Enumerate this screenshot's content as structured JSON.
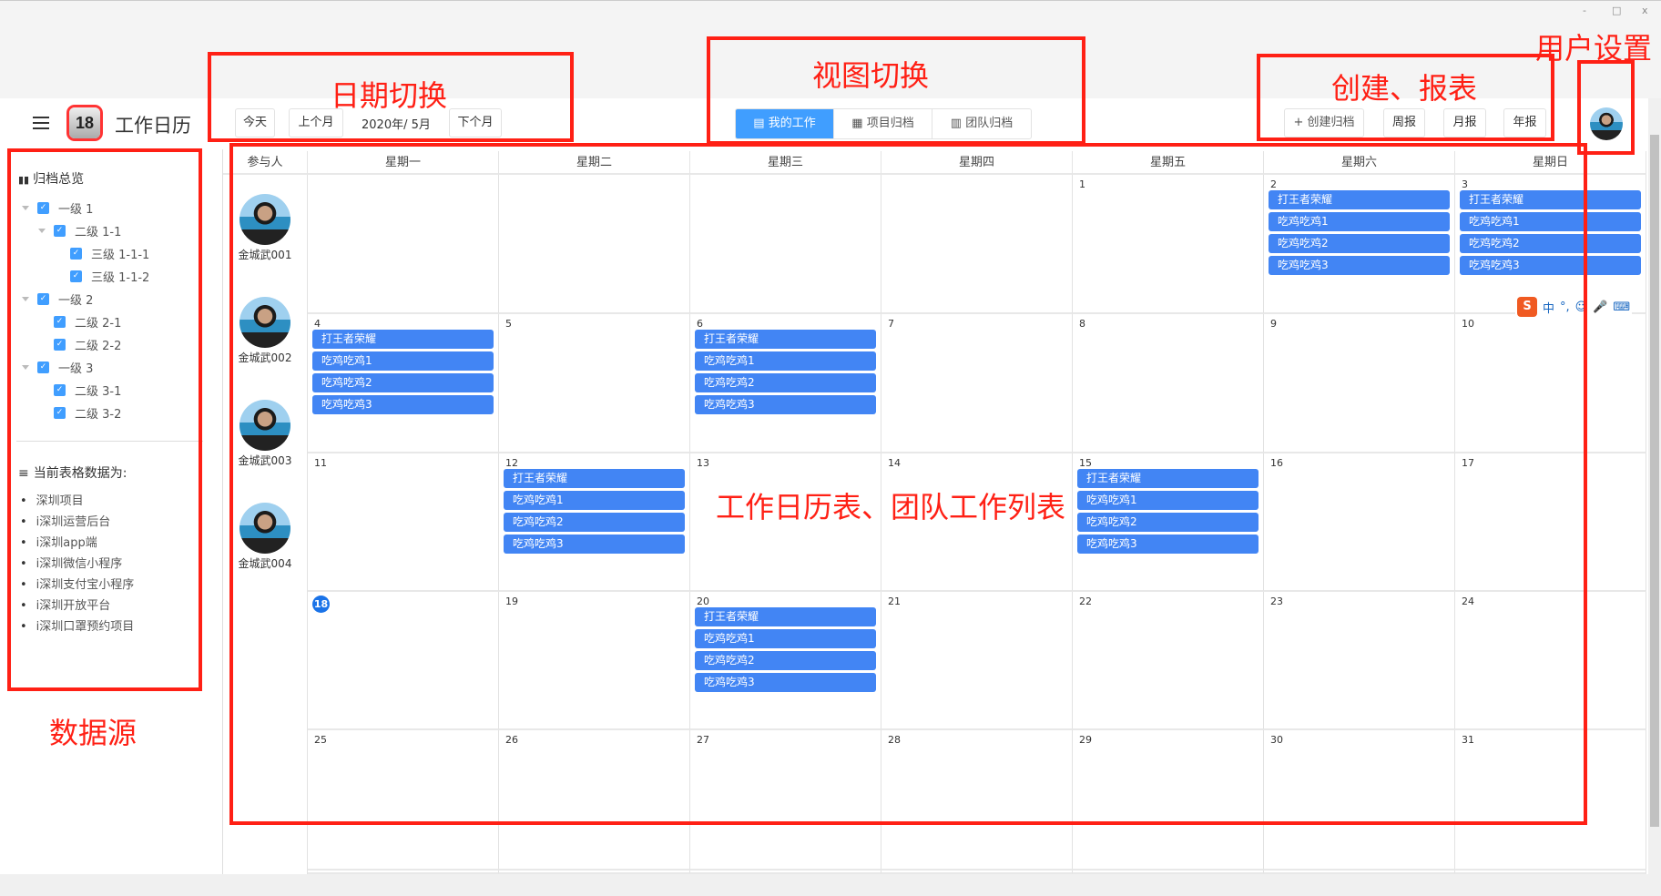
{
  "window": {
    "minimize": "-",
    "maximize": "□",
    "close": "x"
  },
  "header": {
    "title": "工作日历",
    "logo_day": "18",
    "today": "今天",
    "prev": "上个月",
    "month": "2020年/ 5月",
    "next": "下个月",
    "views": [
      {
        "label": "▤ 我的工作",
        "active": true
      },
      {
        "label": "▦ 项目归档",
        "active": false
      },
      {
        "label": "▥ 团队归档",
        "active": false
      }
    ],
    "create": "+ 创建归档",
    "weekly": "周报",
    "monthly": "月报",
    "yearly": "年报"
  },
  "sidebar": {
    "overview_title": "归档总览",
    "tree": [
      {
        "label": "一级 1",
        "level": 0,
        "caret": true
      },
      {
        "label": "二级 1-1",
        "level": 1,
        "caret": true
      },
      {
        "label": "三级 1-1-1",
        "level": 2
      },
      {
        "label": "三级 1-1-2",
        "level": 2
      },
      {
        "label": "一级 2",
        "level": 0,
        "caret": true
      },
      {
        "label": "二级 2-1",
        "level": 1
      },
      {
        "label": "二级 2-2",
        "level": 1
      },
      {
        "label": "一级 3",
        "level": 0,
        "caret": true
      },
      {
        "label": "二级 3-1",
        "level": 1
      },
      {
        "label": "二级 3-2",
        "level": 1
      }
    ],
    "current_title": "当前表格数据为:",
    "sources": [
      "深圳项目",
      "i深圳运营后台",
      "i深圳app端",
      "i深圳微信小程序",
      "i深圳支付宝小程序",
      "i深圳开放平台",
      "i深圳口罩预约项目"
    ]
  },
  "calendar": {
    "participant_header": "参与人",
    "weekdays": [
      "星期一",
      "星期二",
      "星期三",
      "星期四",
      "星期五",
      "星期六",
      "星期日"
    ],
    "participants": [
      "金城武001",
      "金城武002",
      "金城武003",
      "金城武004"
    ],
    "weeks": [
      [
        null,
        null,
        null,
        null,
        1,
        2,
        3
      ],
      [
        4,
        5,
        6,
        7,
        8,
        9,
        10
      ],
      [
        11,
        12,
        13,
        14,
        15,
        16,
        17
      ],
      [
        18,
        19,
        20,
        21,
        22,
        23,
        24
      ],
      [
        25,
        26,
        27,
        28,
        29,
        30,
        31
      ],
      [
        null,
        null,
        null,
        null,
        null,
        null,
        null
      ]
    ],
    "today": 18,
    "events": {
      "2": [
        "打王者荣耀",
        "吃鸡吃鸡1",
        "吃鸡吃鸡2",
        "吃鸡吃鸡3"
      ],
      "3": [
        "打王者荣耀",
        "吃鸡吃鸡1",
        "吃鸡吃鸡2",
        "吃鸡吃鸡3"
      ],
      "4": [
        "打王者荣耀",
        "吃鸡吃鸡1",
        "吃鸡吃鸡2",
        "吃鸡吃鸡3"
      ],
      "6": [
        "打王者荣耀",
        "吃鸡吃鸡1",
        "吃鸡吃鸡2",
        "吃鸡吃鸡3"
      ],
      "12": [
        "打王者荣耀",
        "吃鸡吃鸡1",
        "吃鸡吃鸡2",
        "吃鸡吃鸡3"
      ],
      "15": [
        "打王者荣耀",
        "吃鸡吃鸡1",
        "吃鸡吃鸡2",
        "吃鸡吃鸡3"
      ],
      "20": [
        "打王者荣耀",
        "吃鸡吃鸡1",
        "吃鸡吃鸡2",
        "吃鸡吃鸡3"
      ]
    },
    "event_color": "#4285f4"
  },
  "ime": {
    "logo": "S",
    "mode": "中",
    "punct": "°,"
  },
  "annotations": {
    "date_switch": "日期切换",
    "view_switch": "视图切换",
    "create_report": "创建、报表",
    "user_settings": "用户设置",
    "data_source": "数据源",
    "calendar_area": "工作日历表、团队工作列表",
    "color": "#ff2015"
  }
}
